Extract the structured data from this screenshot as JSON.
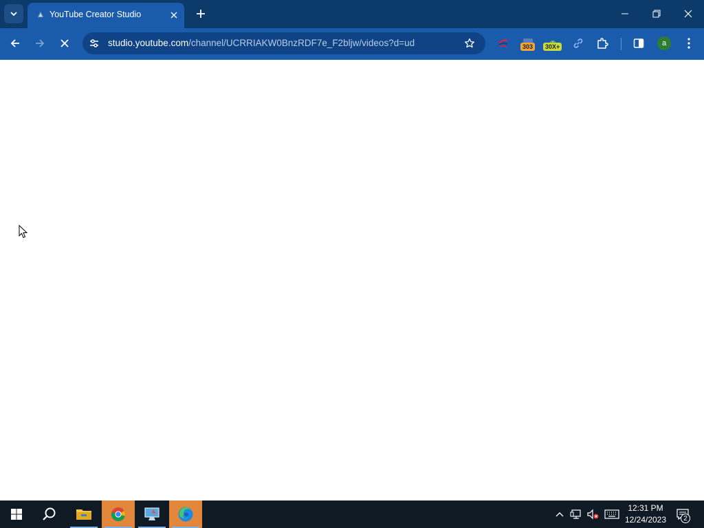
{
  "browser": {
    "tab": {
      "title": "YouTube Creator Studio"
    },
    "address": {
      "host": "studio.youtube.com",
      "path": "/channel/UCRRIAKW0BnzRDF7e_F2bljw/videos?d=ud"
    },
    "extensions": [
      {
        "name": "extension-icon-1",
        "badge": ""
      },
      {
        "name": "extension-icon-2",
        "badge": "303",
        "badge_color": "#f0a53a"
      },
      {
        "name": "extension-icon-3",
        "badge": "30X+",
        "badge_color": "#c7dc3c"
      },
      {
        "name": "link-icon",
        "badge": ""
      },
      {
        "name": "puzzle-icon",
        "badge": ""
      }
    ],
    "profile_initial": "a"
  },
  "taskbar": {
    "apps": [
      {
        "name": "start-button",
        "icon": "windows-icon",
        "active": false
      },
      {
        "name": "search-button",
        "icon": "search-icon",
        "active": false
      },
      {
        "name": "file-explorer",
        "icon": "folder-icon",
        "active": false
      },
      {
        "name": "chrome",
        "icon": "chrome-icon",
        "active": true
      },
      {
        "name": "app-window",
        "icon": "monitor-icon",
        "active": false
      },
      {
        "name": "edge",
        "icon": "edge-icon",
        "active": true
      }
    ],
    "clock": {
      "time": "12:31 PM",
      "date": "12/24/2023"
    },
    "notification_count": "2"
  },
  "colors": {
    "tabstrip": "#0b3a6b",
    "toolbar": "#1a5cab",
    "taskbar": "#0f1a24",
    "taskbar_active": "#e2863b"
  }
}
